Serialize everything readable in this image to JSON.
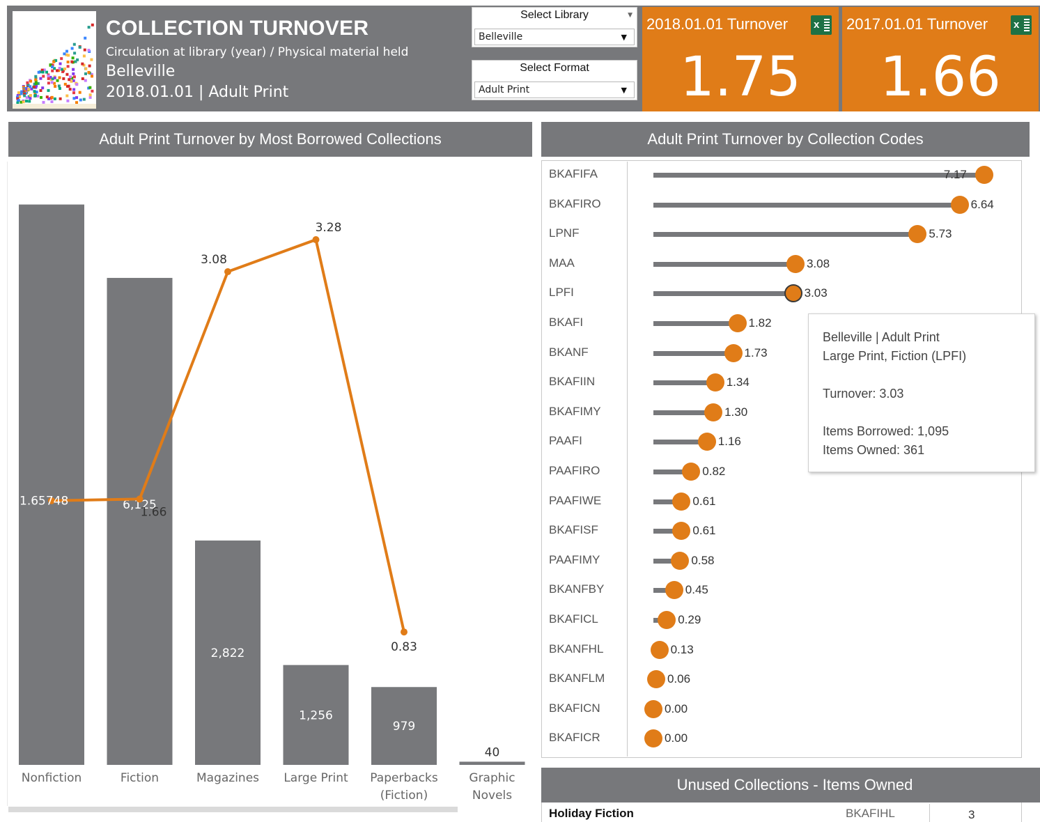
{
  "header": {
    "title": "COLLECTION TURNOVER",
    "subtitle": "Circulation at library (year) / Physical material held",
    "library": "Belleville",
    "date_format": "2018.01.01 | Adult Print"
  },
  "filters": {
    "library": {
      "label": "Select Library",
      "value": "Belleville"
    },
    "format": {
      "label": "Select Format",
      "value": "Adult Print"
    }
  },
  "kpis": [
    {
      "label": "2018.01.01 Turnover",
      "value": "1.75",
      "icon": "excel-icon"
    },
    {
      "label": "2017.01.01 Turnover",
      "value": "1.66",
      "icon": "excel-icon"
    }
  ],
  "colors": {
    "accent": "#e07c18",
    "panel": "#77787b",
    "bar": "#77787b"
  },
  "left_panel": {
    "title": "Adult Print Turnover by Most Borrowed Collections"
  },
  "right_panel": {
    "title": "Adult Print Turnover by Collection Codes"
  },
  "chart_data": [
    {
      "type": "bar",
      "title": "Adult Print Turnover by Most Borrowed Collections",
      "categories": [
        "Nonfiction",
        "Fiction",
        "Magazines",
        "Large Print",
        "Paperbacks (Fiction)",
        "Graphic Novels"
      ],
      "bar_values": [
        7048,
        6125,
        2822,
        1256,
        979,
        40
      ],
      "bar_labels": [
        "1.65748",
        "6,125",
        "2,822",
        "1,256",
        "979",
        "40"
      ],
      "line_values": [
        1.65,
        1.66,
        3.08,
        3.28,
        0.83
      ],
      "line_labels": [
        "",
        "1.66",
        "3.08",
        "3.28",
        "0.83"
      ],
      "ylim_bars": [
        0,
        7500
      ],
      "ylim_line": [
        0,
        3.55
      ]
    },
    {
      "type": "lollipop",
      "title": "Adult Print Turnover by Collection Codes",
      "categories": [
        "BKAFIFA",
        "BKAFIRO",
        "LPNF",
        "MAA",
        "LPFI",
        "BKAFI",
        "BKANF",
        "BKAFIIN",
        "BKAFIMY",
        "PAAFI",
        "PAAFIRO",
        "PAAFIWE",
        "BKAFISF",
        "PAAFIMY",
        "BKANFBY",
        "BKAFICL",
        "BKANFHL",
        "BKANFLM",
        "BKAFICN",
        "BKAFICR"
      ],
      "values": [
        7.17,
        6.64,
        5.73,
        3.08,
        3.03,
        1.82,
        1.73,
        1.34,
        1.3,
        1.16,
        0.82,
        0.61,
        0.61,
        0.58,
        0.45,
        0.29,
        0.13,
        0.06,
        0.0,
        0.0
      ],
      "labels": [
        "7.17",
        "6.64",
        "5.73",
        "3.08",
        "3.03",
        "1.82",
        "1.73",
        "1.34",
        "1.30",
        "1.16",
        "0.82",
        "0.61",
        "0.61",
        "0.58",
        "0.45",
        "0.29",
        "0.13",
        "0.06",
        "0.00",
        "0.00"
      ],
      "xlim": [
        0,
        7.4
      ],
      "selected": "LPFI"
    }
  ],
  "tooltip": {
    "line1": "Belleville | Adult Print",
    "line2": "Large Print, Fiction (LPFI)",
    "turnover": "Turnover:  3.03",
    "borrowed": "Items Borrowed: 1,095",
    "owned": "Items Owned: 361"
  },
  "unused": {
    "title": "Unused Collections - Items Owned",
    "rows": [
      {
        "name": "Holiday Fiction",
        "code": "BKAFIHL",
        "count": "3"
      }
    ]
  }
}
